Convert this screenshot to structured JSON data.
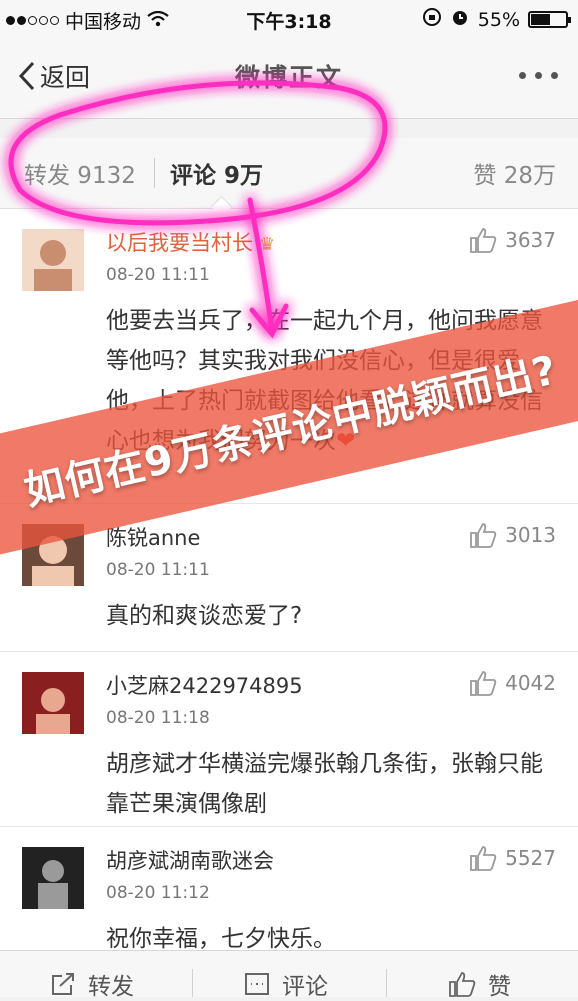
{
  "status_bar": {
    "carrier": "中国移动",
    "time": "下午3:18",
    "battery": "55%",
    "battery_level": 0.55
  },
  "nav": {
    "back_label": "返回",
    "title": "微博正文"
  },
  "tabs": {
    "repost": "转发 9132",
    "comment": "评论 9万",
    "like": "赞 28万"
  },
  "comments": [
    {
      "user": "以后我要当村长",
      "time": "08-20 11:11",
      "likes": "3637",
      "text": "他要去当兵了，在一起九个月，他问我愿意等他吗？其实我对我们没信心，但是很爱他，上了热门就截图给他看，这样就算没信心也想为我们努力一次",
      "avatar_colors": [
        "#f3d9c8",
        "#c98e6f"
      ]
    },
    {
      "user": "陈锐anne",
      "time": "08-20 11:11",
      "likes": "3013",
      "text": "真的和爽谈恋爱了?",
      "avatar_colors": [
        "#6b4a3c",
        "#f0c8b0"
      ]
    },
    {
      "user": "小芝麻2422974895",
      "time": "08-20 11:18",
      "likes": "4042",
      "text": "胡彦斌才华横溢完爆张翰几条街，张翰只能靠芒果演偶像剧",
      "avatar_colors": [
        "#8a1f1f",
        "#e8a890"
      ]
    },
    {
      "user": "胡彦斌湖南歌迷会",
      "time": "08-20 11:12",
      "likes": "5527",
      "text": "祝你幸福，七夕快乐。",
      "avatar_colors": [
        "#222222",
        "#9a9a9a"
      ]
    }
  ],
  "toolbar": {
    "repost": "转发",
    "comment": "评论",
    "like": "赞"
  },
  "overlay": {
    "banner_text": "如何在9万条评论中脱颖而出?",
    "highlight_color": "#ff2fc0",
    "banner_color": "#ec543c"
  }
}
